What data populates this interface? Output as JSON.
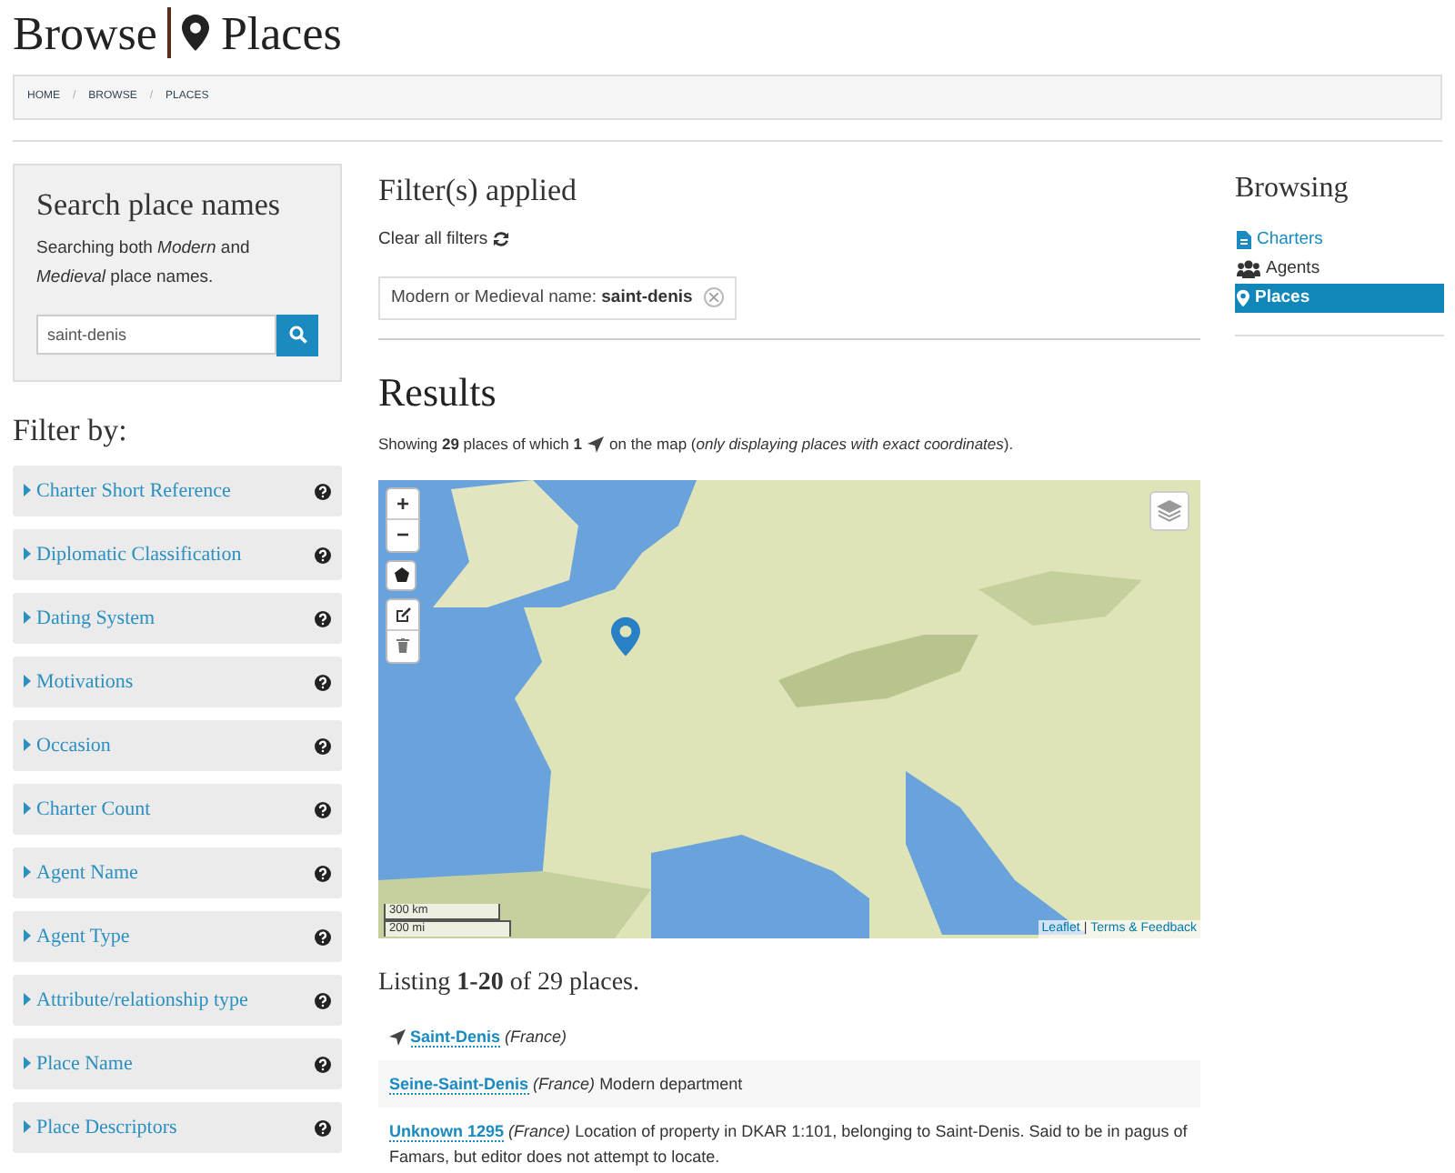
{
  "header": {
    "title_left": "Browse",
    "title_right": "Places"
  },
  "breadcrumbs": [
    {
      "label": "HOME"
    },
    {
      "label": "BROWSE"
    },
    {
      "label": "PLACES"
    }
  ],
  "breadcrumb_separator": "/",
  "search": {
    "title": "Search place names",
    "description": "Searching both *Modern* and *Medieval* place names.",
    "value": "saint-denis"
  },
  "filter_by": {
    "title": "Filter by:",
    "items": [
      {
        "label": "Charter Short Reference"
      },
      {
        "label": "Diplomatic Classification"
      },
      {
        "label": "Dating System"
      },
      {
        "label": "Motivations"
      },
      {
        "label": "Occasion"
      },
      {
        "label": "Charter Count"
      },
      {
        "label": "Agent Name"
      },
      {
        "label": "Agent Type"
      },
      {
        "label": "Attribute/relationship type"
      },
      {
        "label": "Place Name"
      },
      {
        "label": "Place Descriptors"
      }
    ]
  },
  "filters_applied": {
    "title": "Filter(s) applied",
    "clear_label": "Clear all filters",
    "tags": [
      {
        "label": "Modern or Medieval name:",
        "value": "saint-denis"
      }
    ]
  },
  "results": {
    "title": "Results",
    "summary_before": "Showing **29** places of which **1**",
    "summary_after": "on the map (*only displaying places with exact coordinates*).",
    "map": {
      "zoom_in": "+",
      "zoom_out": "−",
      "scale_km": "300 km",
      "scale_mi": "200 mi",
      "attribution_link": "Leaflet",
      "attribution_separator": "|",
      "attribution_rest": "Terms & Feedback"
    },
    "listing": "Listing **1-20** of 29 places.",
    "places": [
      {
        "name": "Saint-Denis",
        "country": "(France)",
        "located": true
      },
      {
        "name": "Seine-Saint-Denis",
        "country": "(France)",
        "description": "Modern department",
        "located": false
      },
      {
        "name": "Unknown 1295",
        "country": "(France)",
        "description": "Location of property in DKAR 1:101, belonging to Saint-Denis. Said to be in pagus of Famars, but editor does not attempt to locate.",
        "located": false
      }
    ]
  },
  "browsing": {
    "title": "Browsing",
    "items": [
      {
        "label": "Charters",
        "kind": "charters",
        "selected": false
      },
      {
        "label": "Agents",
        "kind": "agents",
        "selected": false
      },
      {
        "label": "Places",
        "kind": "places",
        "selected": true
      }
    ]
  }
}
